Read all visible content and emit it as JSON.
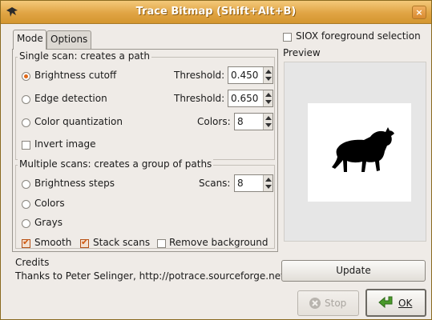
{
  "window": {
    "title": "Trace Bitmap (Shift+Alt+B)",
    "close_glyph": "×"
  },
  "tabs": [
    {
      "label": "Mode",
      "active": true
    },
    {
      "label": "Options",
      "active": false
    }
  ],
  "single_scan": {
    "title": "Single scan: creates a path",
    "brightness": {
      "label": "Brightness cutoff",
      "selected": true,
      "param_label": "Threshold:",
      "value": "0.450"
    },
    "edge": {
      "label": "Edge detection",
      "selected": false,
      "param_label": "Threshold:",
      "value": "0.650"
    },
    "color_quant": {
      "label": "Color quantization",
      "selected": false,
      "param_label": "Colors:",
      "value": "8"
    },
    "invert": {
      "label": "Invert image",
      "checked": false
    }
  },
  "multiple_scans": {
    "title": "Multiple scans: creates a group of paths",
    "brightness_steps": {
      "label": "Brightness steps",
      "selected": false,
      "param_label": "Scans:",
      "value": "8"
    },
    "colors": {
      "label": "Colors",
      "selected": false
    },
    "grays": {
      "label": "Grays",
      "selected": false
    },
    "smooth": {
      "label": "Smooth",
      "checked": true
    },
    "stack_scans": {
      "label": "Stack scans",
      "checked": true
    },
    "remove_background": {
      "label": "Remove background",
      "checked": false
    }
  },
  "siox": {
    "label": "SIOX foreground selection",
    "checked": false
  },
  "preview": {
    "label": "Preview"
  },
  "credits": {
    "title": "Credits",
    "text": "Thanks to Peter Selinger, http://potrace.sourceforge.net"
  },
  "buttons": {
    "update": "Update",
    "stop": "Stop",
    "ok": "OK"
  },
  "colors": {
    "accent": "#e06818",
    "titlebar": "#e0a444",
    "ok_icon": "#4a9a2a",
    "stop_icon": "#a9a59f"
  }
}
